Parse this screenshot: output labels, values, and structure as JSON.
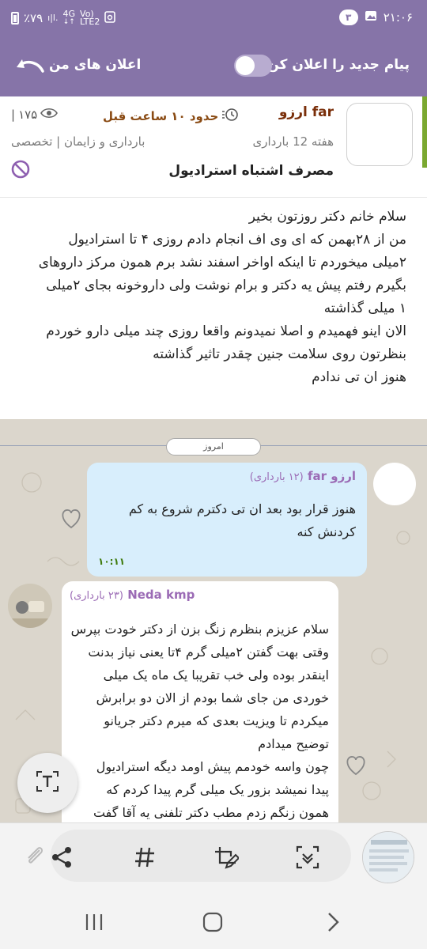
{
  "status_bar": {
    "time": "۲۱:۰۶",
    "notification_count": "۳",
    "battery": "٪۷۹",
    "network_top": "4G",
    "network_bottom": "LTE2",
    "volte": "Vo)"
  },
  "header": {
    "new_message_label": "پیام جدید را اعلان کن",
    "my_notifications_label": "اعلان های من",
    "toggle_on": false
  },
  "post": {
    "author": "ارزو far",
    "time_ago": "حدود ۱۰ ساعت قبل",
    "views": "۱۷۵",
    "week": "هفته 12 بارداری",
    "category": "بارداری و زایمان | تخصصی",
    "title": "مصرف اشتباه استرادیول",
    "body": [
      "سلام خانم دکتر روزتون بخیر",
      "من از ۲۸بهمن  که ای وی اف انجام دادم روزی ۴ تا استرادیول",
      "۲میلی میخوردم تا اینکه اواخر اسفند نشد برم همون مرکز داروهای",
      "بگیرم رفتم پیش یه دکتر و برام نوشت ولی داروخونه بجای ۲میلی",
      "۱ میلی گذاشته",
      "الان اینو فهمیدم و اصلا نمیدونم واقعا روزی چند میلی دارو خوردم",
      "بنظرتون روی سلامت جنین چقدر تاثیر گذاشته",
      "هنوز ان تی ندادم"
    ]
  },
  "chat": {
    "day_label": "امروز",
    "messages": [
      {
        "author": "ارزو far",
        "week": "(۱۲ بارداری)",
        "text": [
          "هنوز قرار بود بعد ان تی دکترم شروع به کم",
          "کردنش کنه"
        ],
        "time": "۱۰:۱۱"
      },
      {
        "author": "Neda kmp",
        "week": "(۲۳ بارداری)",
        "text": [
          "سلام عزیزم بنظرم زنگ بزن از دکتر خودت بپرس",
          "وقتی بهت گفتن ۲میلی گرم ۴تا یعنی نیاز بدنت",
          "اینقدر بوده ولی خب تقریبا یک ماه یک میلی",
          "خوردی من جای شما بودم از الان دو برابرش",
          "میکردم تا ویزیت بعدی که میرم دکتر جریانو",
          "توضیح میدادم",
          "چون واسه خودمم پیش اومد دیگه استرادیول",
          "پیدا نمیشد بزور یک میلی گرم پیدا کردم که",
          "همون زنگم زدم مطب دکتر تلفنی یه آقا گفت"
        ]
      }
    ]
  },
  "colors": {
    "header_purple": "#8674a8",
    "author_brown": "#7a2f0a",
    "chat_name_purple": "#9b6bb5",
    "own_bubble": "#d8eefc",
    "time_green": "#3f7a0c",
    "accent_green": "#7aa830"
  },
  "icons": {
    "back": "back-arrow-icon",
    "views": "eye-icon",
    "time": "clock-icon",
    "report": "ban-icon",
    "like": "heart-icon",
    "text_extract": "text-select-icon",
    "share": "share-icon",
    "hashtag": "hashtag-icon",
    "edit": "edit-crop-icon",
    "scan": "scan-text-icon",
    "attach": "paperclip-icon"
  }
}
